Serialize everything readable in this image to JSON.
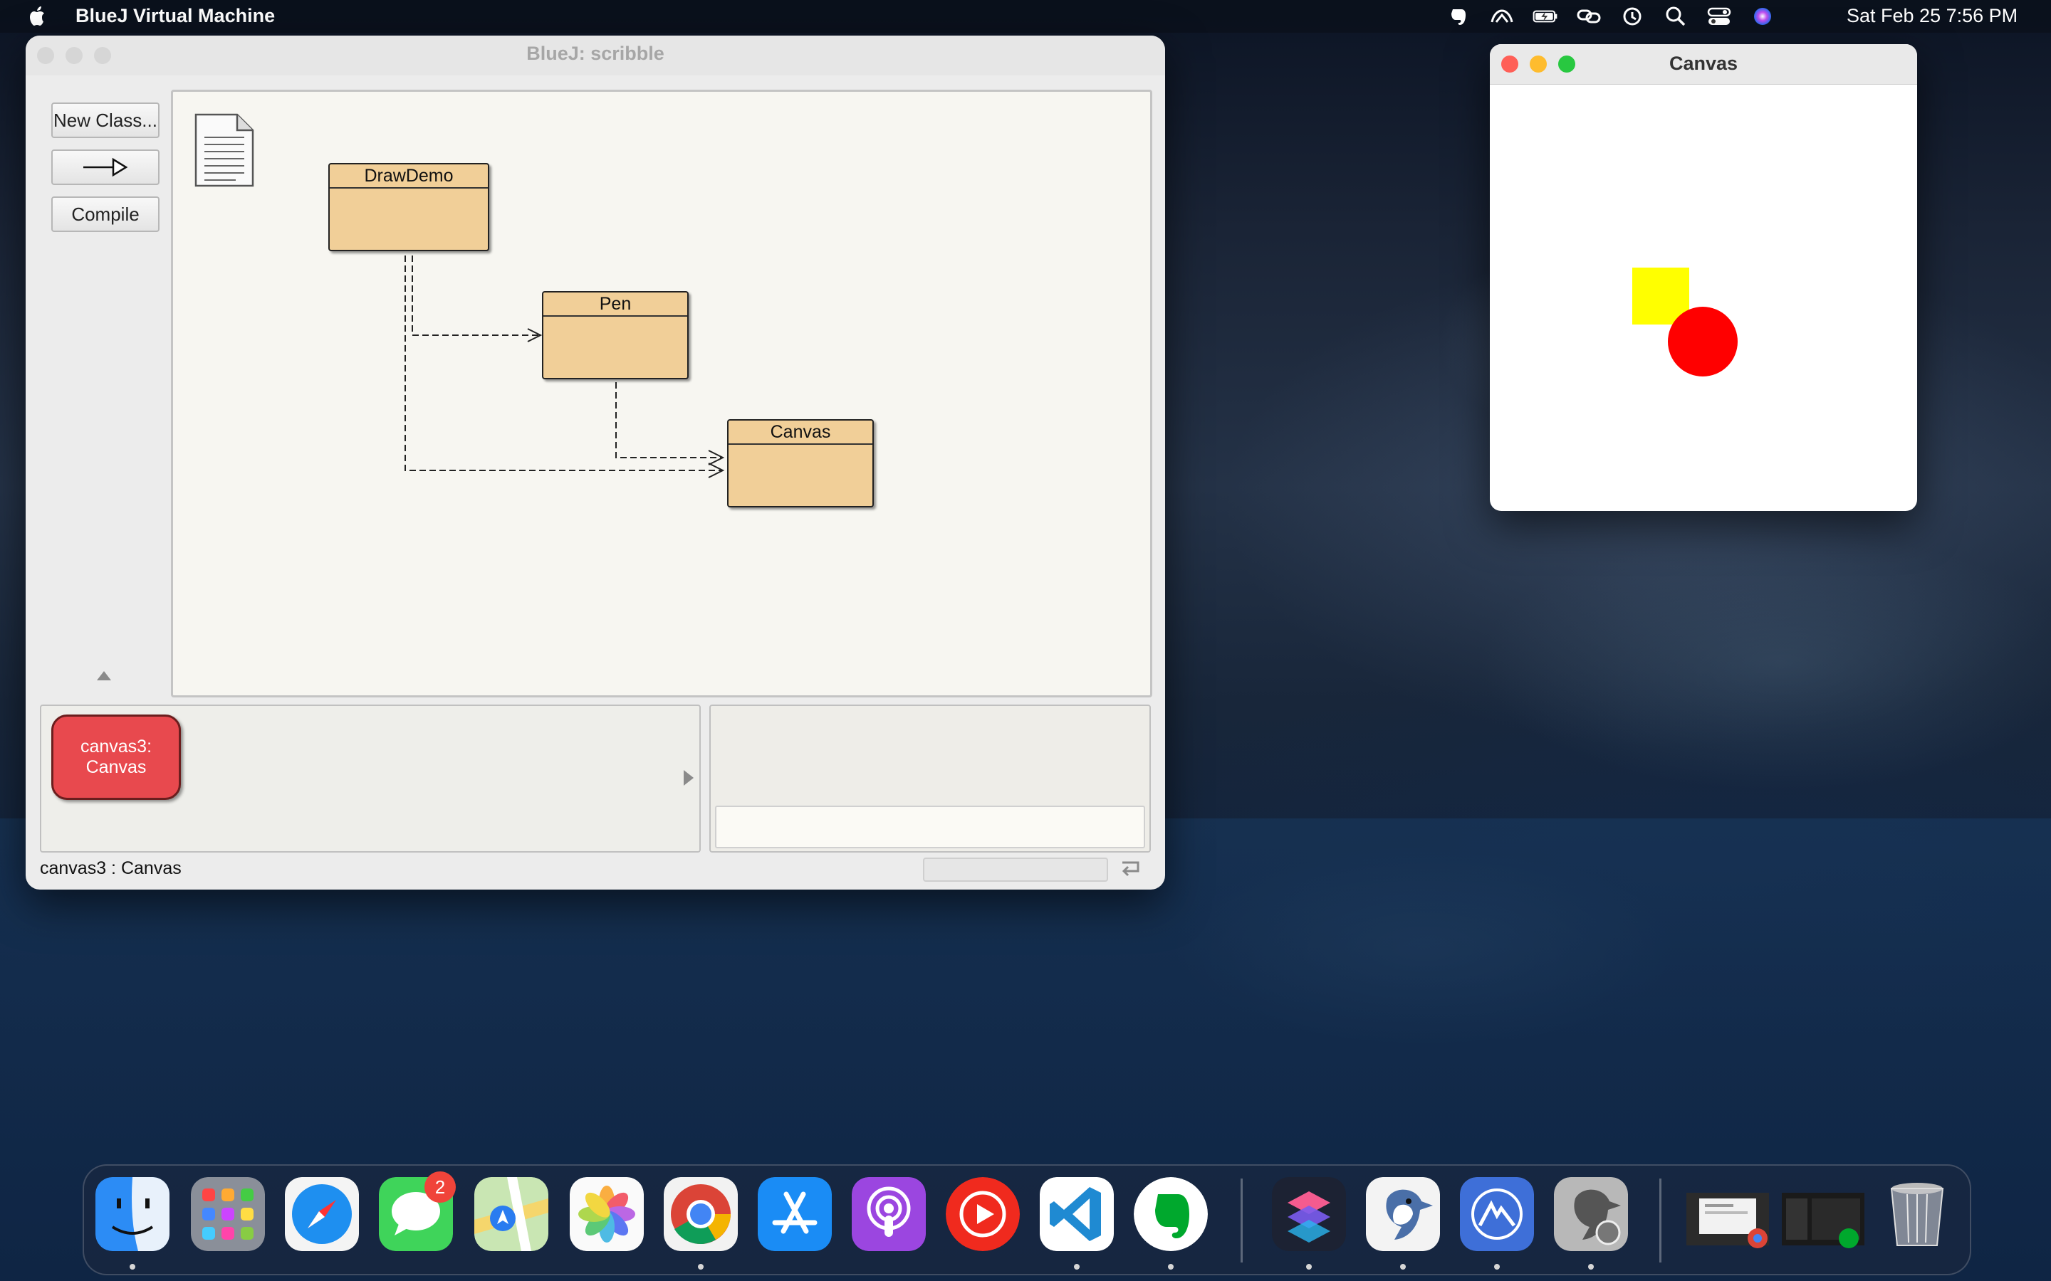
{
  "menubar": {
    "app_name": "BlueJ Virtual Machine",
    "clock": "Sat Feb 25  7:56 PM",
    "status_icons": [
      "evernote-icon",
      "creative-cloud-icon",
      "battery-charging-icon",
      "link-icon",
      "time-machine-icon",
      "spotlight-search-icon",
      "control-center-icon",
      "siri-icon"
    ]
  },
  "bluej": {
    "title": "BlueJ:  scribble",
    "buttons": {
      "new_class": "New Class...",
      "compile": "Compile"
    },
    "classes": [
      {
        "name": "DrawDemo"
      },
      {
        "name": "Pen"
      },
      {
        "name": "Canvas"
      }
    ],
    "object_bench": {
      "object_label_line1": "canvas3:",
      "object_label_line2": "Canvas"
    },
    "status_text": "canvas3 : Canvas"
  },
  "canvas_window": {
    "title": "Canvas",
    "shapes": [
      {
        "kind": "square",
        "color": "#ffff00"
      },
      {
        "kind": "circle",
        "color": "#ff0000"
      }
    ]
  },
  "dock": {
    "apps": [
      "Finder",
      "Launchpad",
      "Safari",
      "Messages",
      "Maps",
      "Photos",
      "Google Chrome",
      "App Store",
      "Podcasts",
      "YouTube Music",
      "Visual Studio Code",
      "Evernote",
      "Shortcuts",
      "BlueJ",
      "Nord VPN",
      "BlueJ Installer"
    ],
    "messages_badge": "2"
  },
  "colors": {
    "class_fill": "#f1cf98",
    "object_fill": "#e8494e",
    "traffic_close": "#ff5f57",
    "traffic_min": "#febc2e",
    "traffic_max": "#28c840"
  }
}
